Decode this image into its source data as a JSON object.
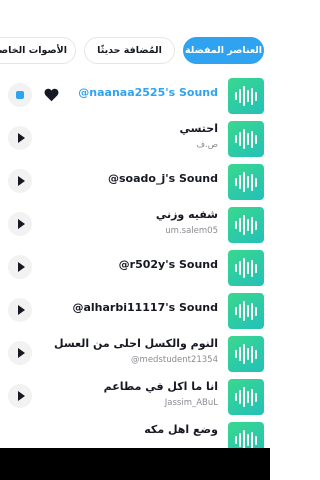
{
  "tabs": [
    {
      "label": "العناصر المفضلة",
      "active": true
    },
    {
      "label": "المُضافة حديثًا",
      "active": false
    },
    {
      "label": "الأصوات الخاصة",
      "active": false
    }
  ],
  "sounds": [
    {
      "title": "@naanaa2525's Sound",
      "subtitle": "",
      "selected": true,
      "favorited": true
    },
    {
      "title": "احتسي",
      "subtitle": "ص.ف",
      "selected": false,
      "favorited": false
    },
    {
      "title": "@soado_j's Sound",
      "subtitle": "",
      "selected": false,
      "favorited": false
    },
    {
      "title": "شفيه وزني",
      "subtitle": "um.salem05",
      "selected": false,
      "favorited": false
    },
    {
      "title": "@r502y's Sound",
      "subtitle": "",
      "selected": false,
      "favorited": false
    },
    {
      "title": "@alharbi11117's Sound",
      "subtitle": "",
      "selected": false,
      "favorited": false
    },
    {
      "title": "النوم والكسل احلى من العسل",
      "subtitle": "@medstudent21354",
      "selected": false,
      "favorited": false
    },
    {
      "title": "انا ما اكل في مطاعم",
      "subtitle": "Jassim_ABuL",
      "selected": false,
      "favorited": false
    },
    {
      "title": "وضع اهل مكه",
      "subtitle": "",
      "selected": false,
      "favorited": false
    }
  ],
  "colors": {
    "accent": "#2fa3f0",
    "thumb_start": "#3ad88d",
    "thumb_end": "#23c0b9"
  }
}
